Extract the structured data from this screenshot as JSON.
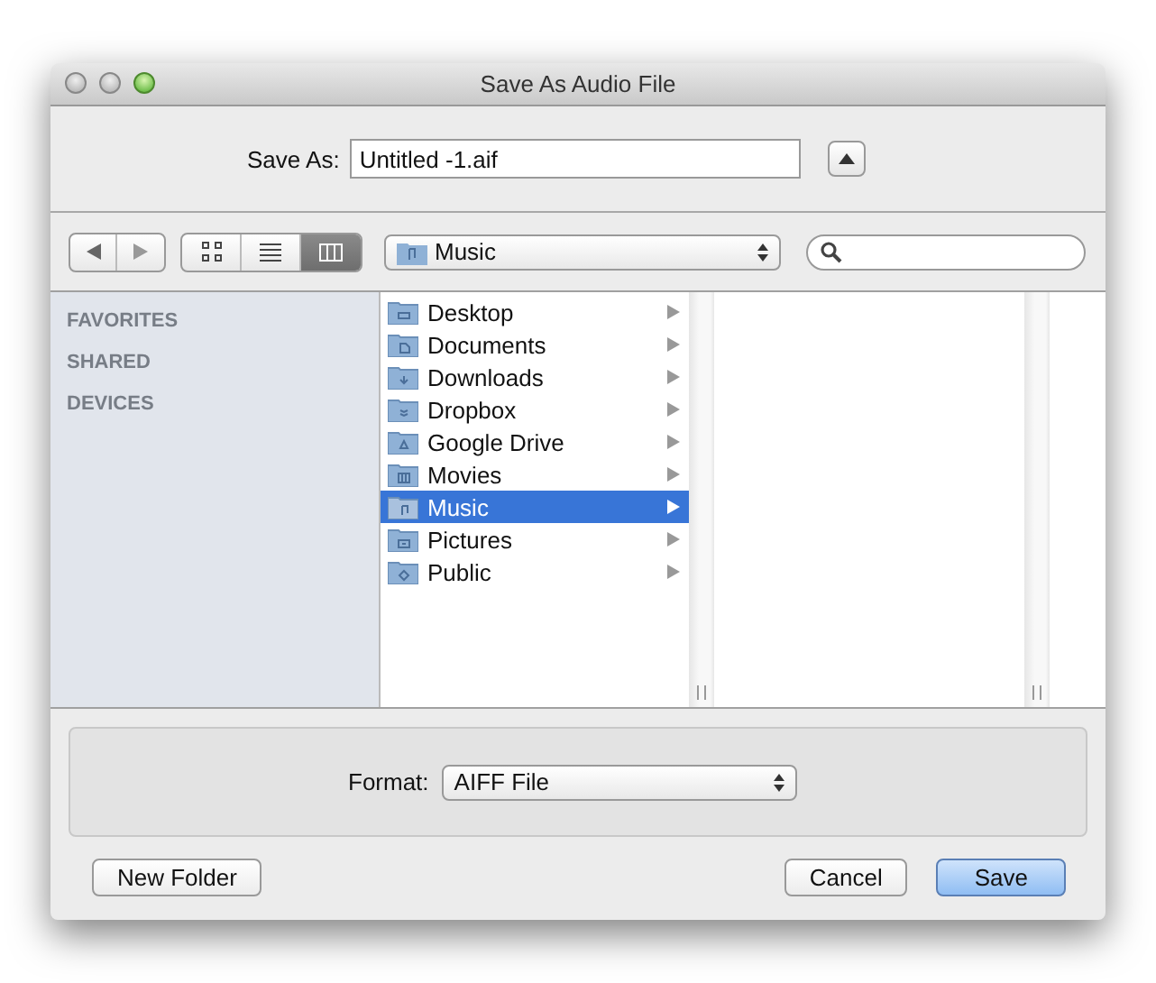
{
  "window": {
    "title": "Save As Audio File"
  },
  "save_as": {
    "label": "Save As:",
    "value": "Untitled -1.aif",
    "expanded": true
  },
  "toolbar": {
    "views": [
      {
        "kind": "icons",
        "selected": false
      },
      {
        "kind": "list",
        "selected": false
      },
      {
        "kind": "columns",
        "selected": true
      }
    ],
    "location": "Music"
  },
  "sidebar": {
    "sections": [
      "FAVORITES",
      "SHARED",
      "DEVICES"
    ]
  },
  "files": [
    {
      "name": "Desktop",
      "kind": "desktop",
      "selected": false
    },
    {
      "name": "Documents",
      "kind": "documents",
      "selected": false
    },
    {
      "name": "Downloads",
      "kind": "downloads",
      "selected": false
    },
    {
      "name": "Dropbox",
      "kind": "dropbox",
      "selected": false
    },
    {
      "name": "Google Drive",
      "kind": "drive",
      "selected": false
    },
    {
      "name": "Movies",
      "kind": "movies",
      "selected": false
    },
    {
      "name": "Music",
      "kind": "music",
      "selected": true
    },
    {
      "name": "Pictures",
      "kind": "pictures",
      "selected": false
    },
    {
      "name": "Public",
      "kind": "public",
      "selected": false
    }
  ],
  "format": {
    "label": "Format:",
    "value": "AIFF File"
  },
  "buttons": [
    {
      "label": "New Folder",
      "default": false
    },
    {
      "label": "Cancel",
      "default": false
    },
    {
      "label": "Save",
      "default": true
    }
  ]
}
